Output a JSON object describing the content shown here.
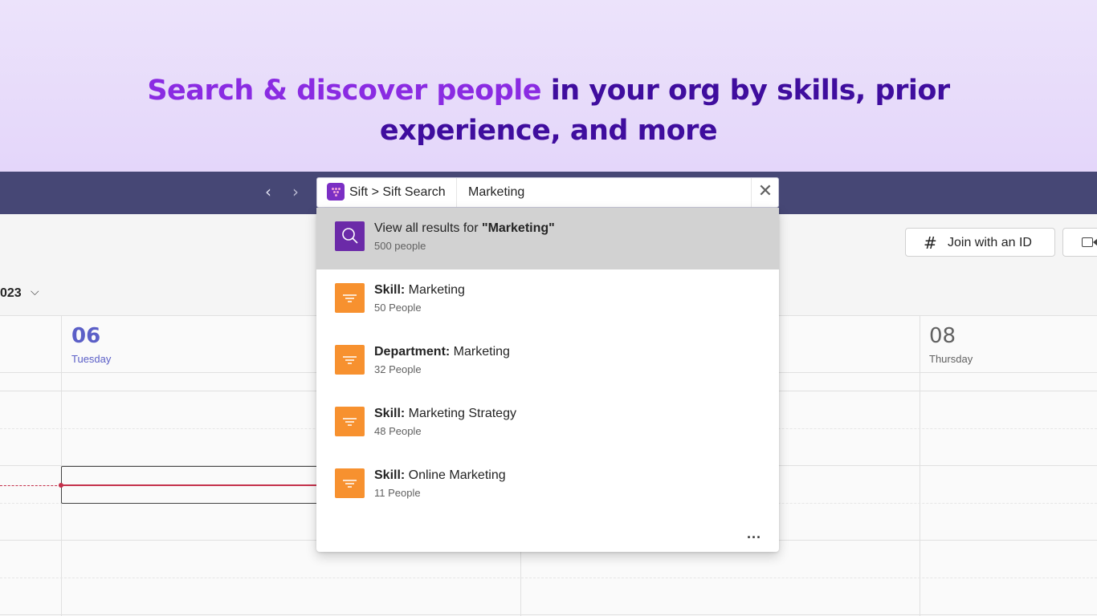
{
  "hero": {
    "accent": "Search & discover people",
    "rest": " in your org by skills, prior experience, and more"
  },
  "topbar": {
    "back_icon": "chevron-left-icon",
    "forward_icon": "chevron-right-icon",
    "breadcrumb": "Sift > Sift Search",
    "query": "Marketing",
    "clear_icon": "close-icon"
  },
  "calendar": {
    "join_button": "Join with an ID",
    "month_label": "023",
    "days": [
      {
        "num": "06",
        "name": "Tuesday"
      },
      {
        "num": "08",
        "name": "Thursday"
      }
    ]
  },
  "dropdown": {
    "view_all": {
      "prefix": "View all results for ",
      "term": "\"Marketing\"",
      "sub": "500 people"
    },
    "results": [
      {
        "key": "Skill:",
        "value": " Marketing",
        "sub": "50 People"
      },
      {
        "key": "Department:",
        "value": " Marketing",
        "sub": "32 People"
      },
      {
        "key": "Skill:",
        "value": " Marketing Strategy",
        "sub": "48 People"
      },
      {
        "key": "Skill:",
        "value": " Online Marketing",
        "sub": "11 People"
      }
    ],
    "more": "..."
  },
  "colors": {
    "brand_purple": "#6b2aa8",
    "accent_orange": "#f7912f",
    "teams_bar": "#464775",
    "today": "#5b5fc7",
    "now_line": "#c4314b"
  }
}
